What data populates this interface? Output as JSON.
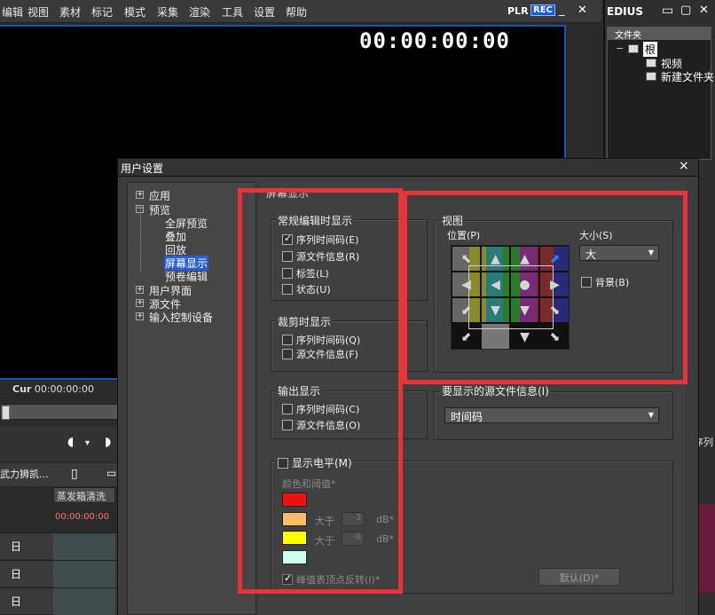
{
  "menubar": {
    "items": [
      "编辑",
      "视图",
      "素材",
      "标记",
      "模式",
      "采集",
      "渲染",
      "工具",
      "设置",
      "帮助"
    ],
    "plr": "PLR",
    "rec": "REC"
  },
  "preview": {
    "timecode": "00:00:00:00"
  },
  "player": {
    "cur_label": "Cur",
    "cur_timecode": "00:00:00:00"
  },
  "timeline": {
    "sequence_name": "武力狮凯...",
    "tab_name": "蒸发箱清洗",
    "ruler_timecode": "00:00:00:00",
    "tracks": [
      "日",
      "日",
      "日",
      "日"
    ]
  },
  "bin": {
    "title": "EDIUS",
    "panel_header": "文件夹",
    "root": "根",
    "children": [
      "视频",
      "新建文件夹"
    ],
    "cut_label": "序列"
  },
  "dialog": {
    "title": "用户设置",
    "close": "×",
    "tree": [
      {
        "label": "应用",
        "expander": "+"
      },
      {
        "label": "预览",
        "expander": "−"
      },
      {
        "label": "全屏预览"
      },
      {
        "label": "叠加"
      },
      {
        "label": "回放"
      },
      {
        "label": "屏幕显示"
      },
      {
        "label": "预卷编辑"
      },
      {
        "label": "用户界面",
        "expander": "+"
      },
      {
        "label": "源文件",
        "expander": "+"
      },
      {
        "label": "输入控制设备",
        "expander": "+"
      }
    ],
    "section_title": "屏幕显示",
    "normal_group": {
      "title": "常规编辑时显示",
      "items": [
        {
          "label": "序列时间码(E)",
          "checked": true
        },
        {
          "label": "源文件信息(R)",
          "checked": false
        },
        {
          "label": "标签(L)",
          "checked": false
        },
        {
          "label": "状态(U)",
          "checked": false
        }
      ]
    },
    "trim_group": {
      "title": "裁剪时显示",
      "items": [
        {
          "label": "序列时间码(Q)",
          "checked": false
        },
        {
          "label": "源文件信息(F)",
          "checked": false
        }
      ]
    },
    "output_group": {
      "title": "输出显示",
      "items": [
        {
          "label": "序列时间码(C)",
          "checked": false
        },
        {
          "label": "源文件信息(O)",
          "checked": false
        }
      ]
    },
    "view_group": {
      "title": "视图",
      "position_label": "位置(P)",
      "size_label": "大小(S)",
      "size_value": "大",
      "background_label": "背景(B)",
      "background_checked": false
    },
    "source_info": {
      "title": "要显示的源文件信息(I)",
      "value": "时间码"
    },
    "level_group": {
      "title": "显示电平(M)",
      "checked": false,
      "color_label": "颜色和阈值*",
      "greater_label": "大于",
      "unit": "dB*",
      "thresholds": [
        "-3",
        "-6"
      ],
      "colors": [
        "#ee1111",
        "#ffbb66",
        "#ffff00",
        "#ccffee"
      ],
      "peak_label": "峰值表顶点反转(I)*",
      "peak_checked": true
    },
    "default_button": "默认(D)*"
  }
}
